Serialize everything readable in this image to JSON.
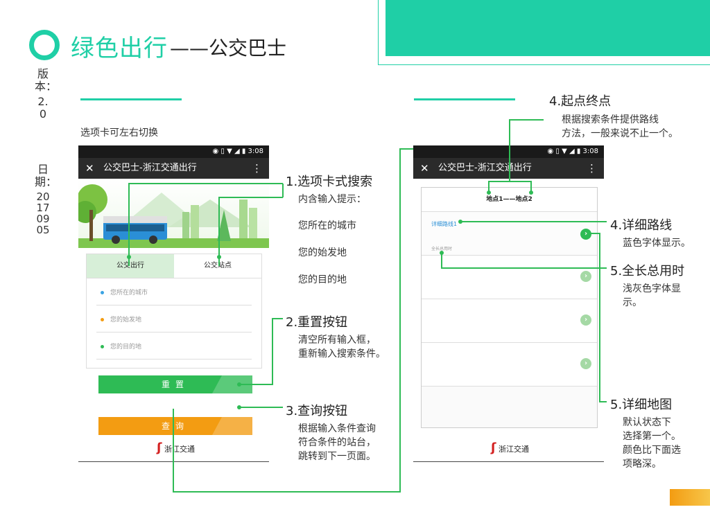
{
  "header": {
    "title_green": "绿色出行",
    "title_dark": "——公交巴士"
  },
  "meta": {
    "version_label": "版本：",
    "version_value": "2.0",
    "date_label": "日期：",
    "date_value": "20170905"
  },
  "left_caption": "选项卡可左右切换",
  "phone_left": {
    "status_time": "3:08",
    "app_title": "公交巴士-浙江交通出行",
    "tabs": [
      "公交出行",
      "公交站点"
    ],
    "fields": [
      {
        "placeholder": "您所在的城市",
        "dot_color": "#3aa3e3"
      },
      {
        "placeholder": "您的始发地",
        "dot_color": "#f39c12"
      },
      {
        "placeholder": "您的目的地",
        "dot_color": "#2ebb55"
      }
    ],
    "reset_label": "重置",
    "query_label": "查询",
    "footer_logo": "浙江交通"
  },
  "phone_right": {
    "status_time": "3:08",
    "app_title": "公交巴士-浙江交通出行",
    "route_header": "地点1——地点2",
    "first_route_name": "详细路线1",
    "first_route_time": "全长总用时",
    "footer_logo": "浙江交通"
  },
  "annotations": {
    "a1_title": "1.选项卡式搜索",
    "a1_lines": [
      "内含输入提示：",
      "您所在的城市",
      "您的始发地",
      "您的目的地"
    ],
    "a2_title": "2.重置按钮",
    "a2_lines": [
      "清空所有输入框，",
      "重新输入搜索条件。"
    ],
    "a3_title": "3.查询按钮",
    "a3_lines": [
      "根据输入条件查询",
      "符合条件的站台，",
      "跳转到下一页面。"
    ],
    "a4_title": "4.起点终点",
    "a4_lines": [
      "根据搜索条件提供路线",
      "方法，一般来说不止一个。"
    ],
    "a5a_title": "4.详细路线",
    "a5a_lines": [
      "蓝色字体显示。"
    ],
    "a5b_title": "5.全长总用时",
    "a5b_lines": [
      "浅灰色字体显",
      "示。"
    ],
    "a6_title": "5.详细地图",
    "a6_lines": [
      "默认状态下",
      "选择第一个。",
      "颜色比下面选",
      "项略深。"
    ]
  },
  "colors": {
    "accent": "#1fcfa6",
    "connector": "#2ebb55",
    "reset_button": "#2ebb55",
    "query_button": "#f39c12",
    "route_blue": "#2a8fd6"
  }
}
